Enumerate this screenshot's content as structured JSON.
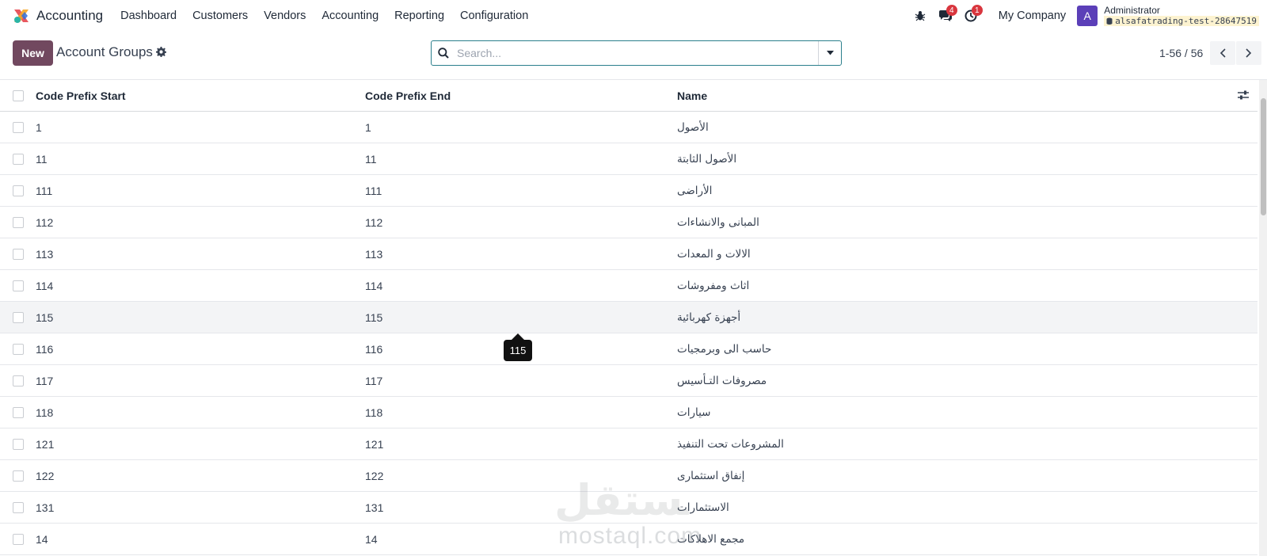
{
  "navbar": {
    "app_name": "Accounting",
    "menu": [
      "Dashboard",
      "Customers",
      "Vendors",
      "Accounting",
      "Reporting",
      "Configuration"
    ],
    "messages_count": "4",
    "activities_count": "1",
    "company": "My Company",
    "avatar_letter": "A",
    "user_name": "Administrator",
    "database": "alsafatrading-test-28647519"
  },
  "control_panel": {
    "new_label": "New",
    "title": "Account Groups",
    "search_placeholder": "Search...",
    "pager": "1-56 / 56"
  },
  "table": {
    "headers": [
      "Code Prefix Start",
      "Code Prefix End",
      "Name"
    ],
    "rows": [
      {
        "start": "1",
        "end": "1",
        "name": "الأصول"
      },
      {
        "start": "11",
        "end": "11",
        "name": "الأصول الثابتة"
      },
      {
        "start": "111",
        "end": "111",
        "name": "الأراضى"
      },
      {
        "start": "112",
        "end": "112",
        "name": "المبانى والانشاءات"
      },
      {
        "start": "113",
        "end": "113",
        "name": "الالات و المعدات"
      },
      {
        "start": "114",
        "end": "114",
        "name": "اثاث ومفروشات"
      },
      {
        "start": "115",
        "end": "115",
        "name": "أجهزة كهربائية"
      },
      {
        "start": "116",
        "end": "116",
        "name": "حاسب الى وبرمجيات"
      },
      {
        "start": "117",
        "end": "117",
        "name": "مصروفات التـأسيس"
      },
      {
        "start": "118",
        "end": "118",
        "name": "سيارات"
      },
      {
        "start": "121",
        "end": "121",
        "name": "المشروعات تحت التنفيذ"
      },
      {
        "start": "122",
        "end": "122",
        "name": "إنفاق استثمارى"
      },
      {
        "start": "131",
        "end": "131",
        "name": "الاستثمارات"
      },
      {
        "start": "14",
        "end": "14",
        "name": "مجمع الاهلاكات"
      }
    ],
    "hover_row_index": 6
  },
  "tooltip": {
    "text": "115"
  },
  "watermark": {
    "text": "mostaql.com",
    "logo_text": "مستقل"
  },
  "colors": {
    "primary": "#71485f",
    "search_border": "#2b7f8c",
    "badge": "#d9363e",
    "avatar": "#5b3fb8",
    "db_highlight": "#fdf3d0"
  }
}
